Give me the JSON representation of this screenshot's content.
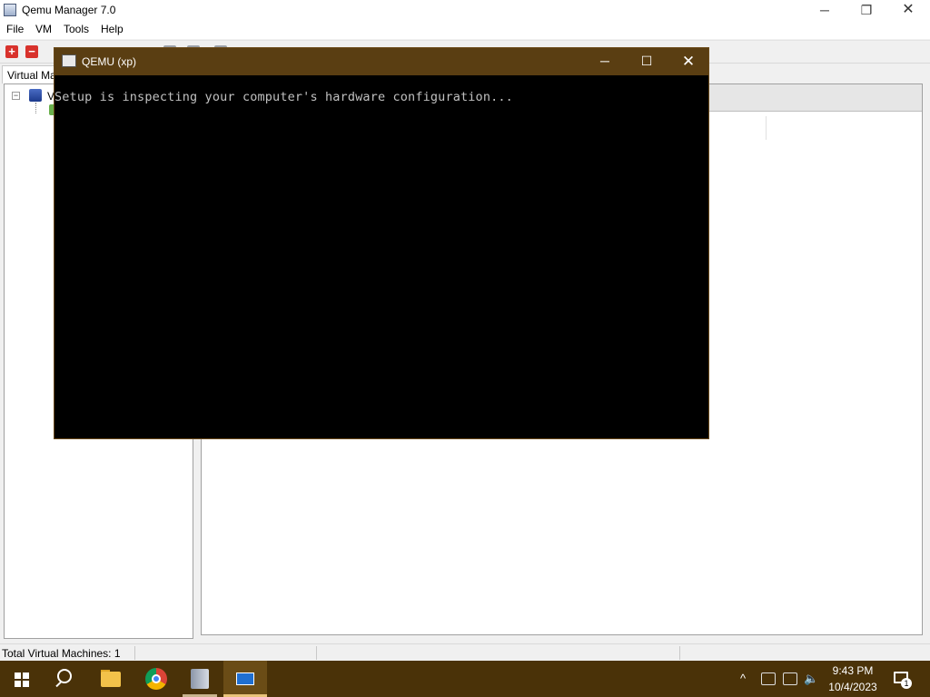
{
  "main_window": {
    "title": "Qemu Manager 7.0",
    "controls": {
      "minimize": "─",
      "restore": "❐",
      "close": "✕"
    }
  },
  "menu": {
    "file": "File",
    "vm": "VM",
    "tools": "Tools",
    "help": "Help"
  },
  "toolbar": {
    "add_icon": "+",
    "remove_icon": "−"
  },
  "tabs": {
    "virtual_machines": "Virtual Mac"
  },
  "tree": {
    "root_label": "V",
    "expander": "−"
  },
  "status_bar": {
    "text": "Total Virtual Machines: 1"
  },
  "qemu_window": {
    "title": "QEMU (xp)",
    "controls": {
      "minimize": "─",
      "maximize": "☐",
      "close": "✕"
    },
    "console_text": "Setup is inspecting your computer's hardware configuration..."
  },
  "taskbar": {
    "clock_time": "9:43 PM",
    "clock_date": "10/4/2023",
    "tray_chevron": "^",
    "volume_icon": "🔈",
    "notification_count": "1",
    "colors": {
      "background": "#4a3208",
      "active_app": "#6a4c16",
      "accent": "#e8c27a"
    }
  }
}
